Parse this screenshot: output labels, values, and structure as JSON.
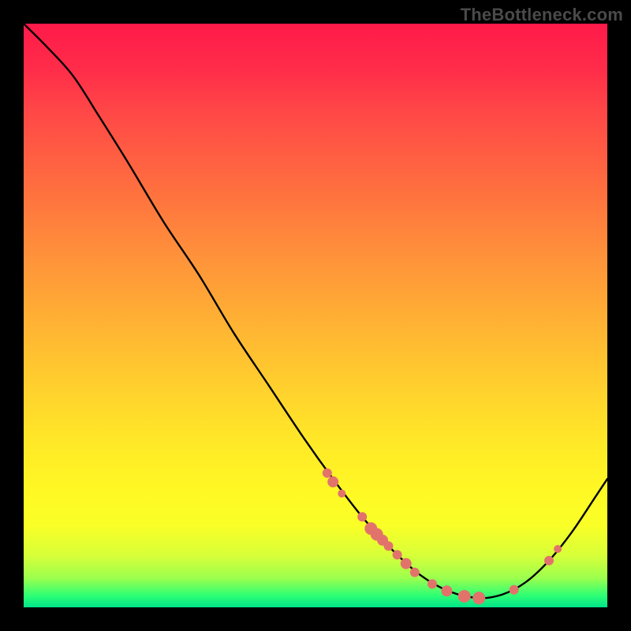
{
  "watermark": "TheBottleneck.com",
  "colors": {
    "curve_stroke": "#000000",
    "marker_fill": "#e2736b",
    "marker_stroke": "#d85f59"
  },
  "chart_data": {
    "type": "line",
    "title": "",
    "xlabel": "",
    "ylabel": "",
    "xlim": [
      0,
      100
    ],
    "ylim": [
      0,
      100
    ],
    "grid": false,
    "legend": false,
    "note": "x normalized 0–100 along horizontal plot area; y normalized 0–100 along vertical plot area (0 = bottom). Curve is a smooth valley; markers are highlighted points on the curve.",
    "curve": [
      {
        "x": 0.0,
        "y": 100.0
      },
      {
        "x": 4.0,
        "y": 96.0
      },
      {
        "x": 8.5,
        "y": 91.0
      },
      {
        "x": 13.0,
        "y": 84.0
      },
      {
        "x": 18.0,
        "y": 76.0
      },
      {
        "x": 24.0,
        "y": 66.0
      },
      {
        "x": 30.0,
        "y": 57.0
      },
      {
        "x": 36.0,
        "y": 47.0
      },
      {
        "x": 42.0,
        "y": 38.0
      },
      {
        "x": 48.0,
        "y": 29.0
      },
      {
        "x": 53.0,
        "y": 22.0
      },
      {
        "x": 58.0,
        "y": 15.5
      },
      {
        "x": 63.0,
        "y": 10.0
      },
      {
        "x": 68.0,
        "y": 5.5
      },
      {
        "x": 73.0,
        "y": 2.7
      },
      {
        "x": 78.0,
        "y": 1.6
      },
      {
        "x": 82.0,
        "y": 2.2
      },
      {
        "x": 86.0,
        "y": 4.3
      },
      {
        "x": 90.0,
        "y": 8.0
      },
      {
        "x": 94.0,
        "y": 13.0
      },
      {
        "x": 98.0,
        "y": 19.0
      },
      {
        "x": 100.0,
        "y": 22.0
      }
    ],
    "markers": [
      {
        "x": 52.0,
        "y": 23.0,
        "r": 6
      },
      {
        "x": 53.0,
        "y": 21.5,
        "r": 7
      },
      {
        "x": 54.5,
        "y": 19.5,
        "r": 5
      },
      {
        "x": 58.0,
        "y": 15.5,
        "r": 6
      },
      {
        "x": 59.5,
        "y": 13.5,
        "r": 8
      },
      {
        "x": 60.5,
        "y": 12.5,
        "r": 8
      },
      {
        "x": 61.5,
        "y": 11.5,
        "r": 7
      },
      {
        "x": 62.5,
        "y": 10.5,
        "r": 6
      },
      {
        "x": 64.0,
        "y": 9.0,
        "r": 6
      },
      {
        "x": 65.5,
        "y": 7.5,
        "r": 7
      },
      {
        "x": 67.0,
        "y": 6.0,
        "r": 6
      },
      {
        "x": 70.0,
        "y": 4.0,
        "r": 6
      },
      {
        "x": 72.5,
        "y": 2.8,
        "r": 7
      },
      {
        "x": 75.5,
        "y": 1.9,
        "r": 8
      },
      {
        "x": 78.0,
        "y": 1.6,
        "r": 8
      },
      {
        "x": 84.0,
        "y": 3.0,
        "r": 6
      },
      {
        "x": 90.0,
        "y": 8.0,
        "r": 6
      },
      {
        "x": 91.5,
        "y": 10.0,
        "r": 5
      }
    ]
  }
}
